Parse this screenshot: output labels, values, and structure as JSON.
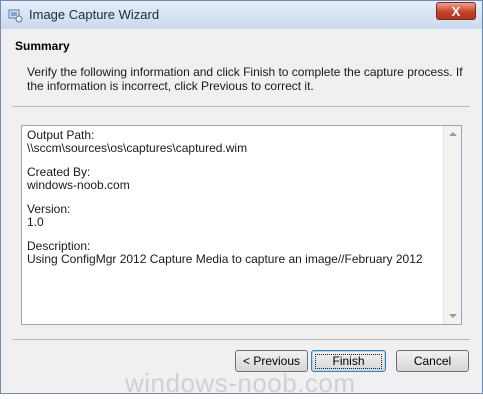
{
  "window": {
    "title": "Image Capture Wizard",
    "close_label": "X"
  },
  "summary": {
    "heading": "Summary",
    "instructions": "Verify the following information and click Finish to complete the capture process.  If the information is incorrect, click Previous to correct it."
  },
  "details": {
    "output_path_label": "Output Path:",
    "output_path_value": "\\\\sccm\\sources\\os\\captures\\captured.wim",
    "created_by_label": "Created By:",
    "created_by_value": "windows-noob.com",
    "version_label": "Version:",
    "version_value": "1.0",
    "description_label": "Description:",
    "description_value": "Using ConfigMgr 2012 Capture Media to capture an image//February 2012"
  },
  "buttons": {
    "previous": "< Previous",
    "finish": "Finish",
    "cancel": "Cancel"
  },
  "watermark": "windows-noob.com"
}
